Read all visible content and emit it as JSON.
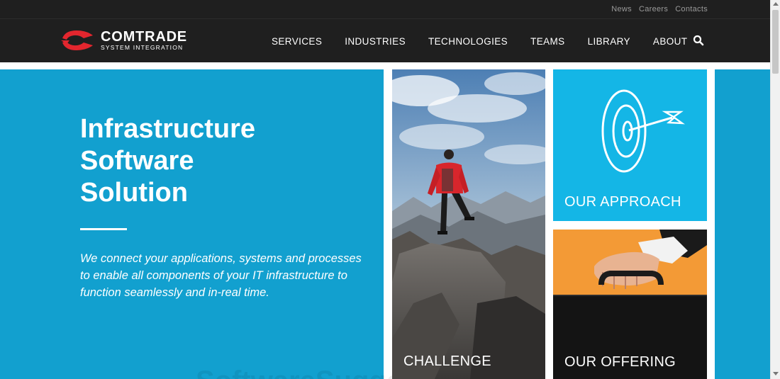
{
  "top_links": [
    "News",
    "Careers",
    "Contacts"
  ],
  "brand": {
    "name": "COMTRADE",
    "tagline": "SYSTEM INTEGRATION",
    "accent_color": "#e3262e"
  },
  "nav": {
    "items": [
      "SERVICES",
      "INDUSTRIES",
      "TECHNOLOGIES",
      "TEAMS",
      "LIBRARY",
      "ABOUT"
    ],
    "search_icon": "search-icon"
  },
  "hero": {
    "title_lines": [
      "Infrastructure",
      "Software",
      "Solution"
    ],
    "description": "We connect your applications, systems and processes to enable all components of your IT infrastructure to function seamlessly and in-real time.",
    "watermark": "SoftwareSuggest",
    "background_color": "#12a0cf"
  },
  "tiles": {
    "challenge": "CHALLENGE",
    "approach": "OUR APPROACH",
    "offering": "OUR OFFERING",
    "approach_color": "#14b6e6",
    "offering_top_color": "#f39a36"
  }
}
